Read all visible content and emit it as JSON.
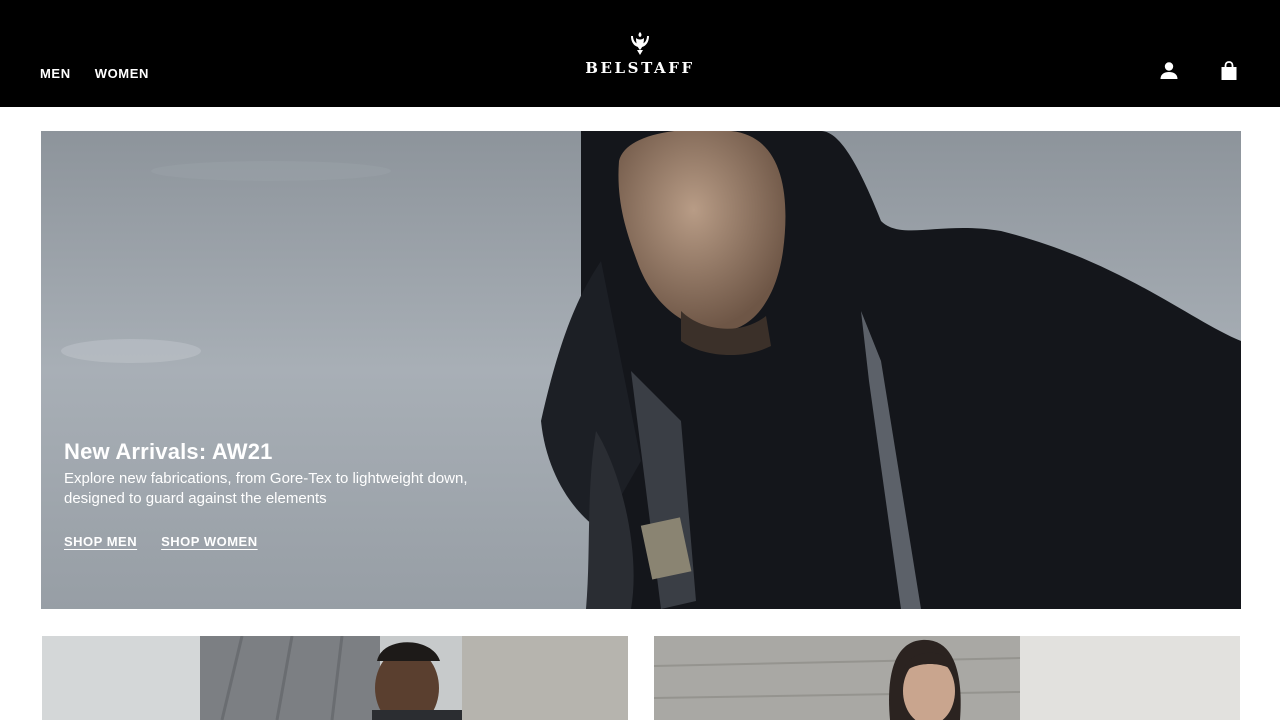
{
  "header": {
    "nav": [
      {
        "label": "MEN"
      },
      {
        "label": "WOMEN"
      }
    ],
    "logo_text": "BELSTAFF",
    "icons": [
      "account-icon",
      "shopping-bag-icon"
    ],
    "background": "#000000"
  },
  "hero": {
    "title": "New Arrivals: AW21",
    "description_line1": "Explore new fabrications, from Gore-Tex to lightweight down,",
    "description_line2": "designed to guard against the elements",
    "cta_men": "SHOP MEN",
    "cta_women": "SHOP WOMEN"
  },
  "tiles": [
    {
      "name": "men-category-tile"
    },
    {
      "name": "women-category-tile"
    }
  ],
  "colors": {
    "header_bg": "#000000",
    "text_on_dark": "#ffffff",
    "page_bg": "#ffffff"
  }
}
